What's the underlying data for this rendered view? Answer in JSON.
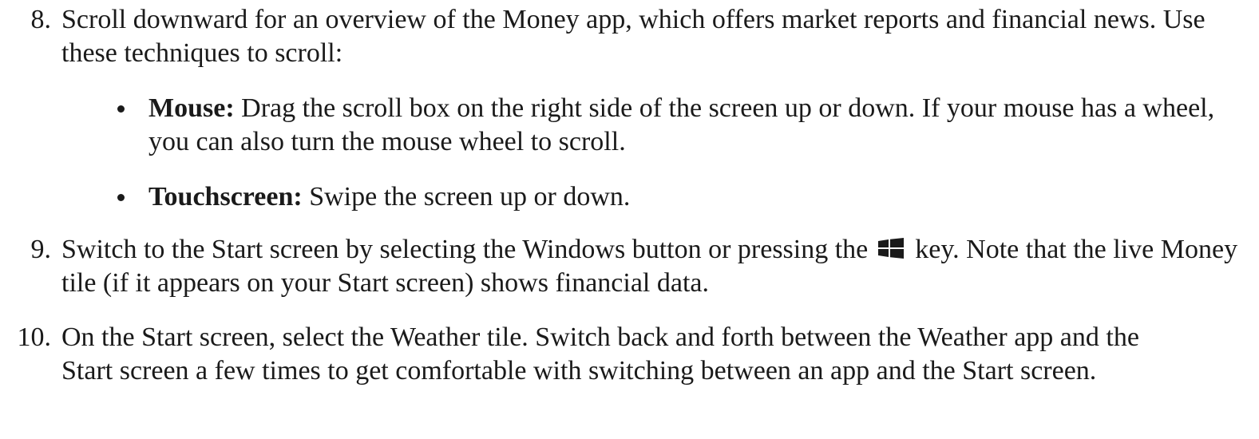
{
  "steps": [
    {
      "number": "8.",
      "text": "Scroll downward for an overview of the Money app, which offers market reports and financial news. Use these techniques to scroll:",
      "bullets": [
        {
          "label": "Mouse:",
          "text": "Drag the scroll box on the right side of the screen up or down. If your mouse has a wheel, you can also turn the mouse wheel to scroll."
        },
        {
          "label": "Touchscreen:",
          "text": "Swipe the screen up or down."
        }
      ]
    },
    {
      "number": "9.",
      "text_before_icon": "Switch to the Start screen by selecting the Windows button or pressing the",
      "icon": "windows-logo-icon",
      "text_after_icon": "key. Note that the live Money tile (if it appears on your Start screen) shows financial data."
    },
    {
      "number": "10.",
      "text": "On the Start screen, select the Weather tile. Switch back and forth between the Weather app and the Start screen a few times to get comfortable with switching between an app and the Start screen."
    }
  ]
}
